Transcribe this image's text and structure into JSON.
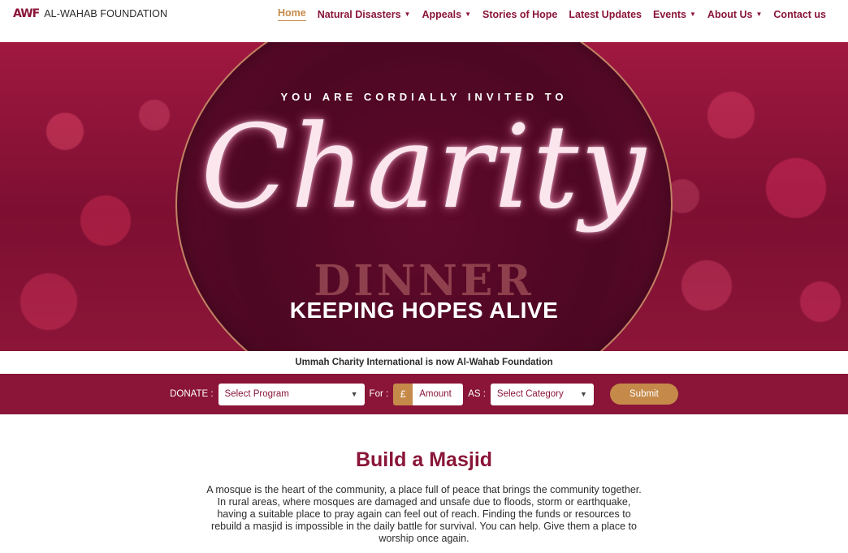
{
  "header": {
    "logo_mark": "AWF",
    "logo_text": "AL-WAHAB FOUNDATION",
    "menu": [
      {
        "label": "Home",
        "active": true,
        "dropdown": false
      },
      {
        "label": "Natural Disasters",
        "active": false,
        "dropdown": true
      },
      {
        "label": "Appeals",
        "active": false,
        "dropdown": true
      },
      {
        "label": "Stories of Hope",
        "active": false,
        "dropdown": false
      },
      {
        "label": "Latest Updates",
        "active": false,
        "dropdown": false
      },
      {
        "label": "Events",
        "active": false,
        "dropdown": true
      },
      {
        "label": "About Us",
        "active": false,
        "dropdown": true
      },
      {
        "label": "Contact us",
        "active": false,
        "dropdown": false
      }
    ]
  },
  "hero": {
    "subtitle": "YOU ARE CORDIALLY INVITED TO",
    "script": "Charity",
    "dinner": "DINNER",
    "tagline": "KEEPING HOPES ALIVE"
  },
  "notice": "Ummah Charity International is now Al-Wahab Foundation",
  "donate": {
    "label": "DONATE :",
    "program_placeholder": "Select Program",
    "for_label": "For :",
    "currency": "£",
    "amount_placeholder": "Amount",
    "as_label": "AS :",
    "category_placeholder": "Select Category",
    "submit": "Submit"
  },
  "section": {
    "title": "Build a Masjid",
    "body": "A mosque is the heart of the community, a place full of peace that brings the community together. In rural areas, where mosques are damaged and unsafe due to floods, storm or earthquake, having a suitable place to pray again can feel out of reach. Finding the funds or resources to rebuild a masjid is impossible in the daily battle for survival.  You can help. Give them a place to worship once again."
  },
  "colors": {
    "brand": "#8a1538",
    "accent": "#c58a4a"
  }
}
